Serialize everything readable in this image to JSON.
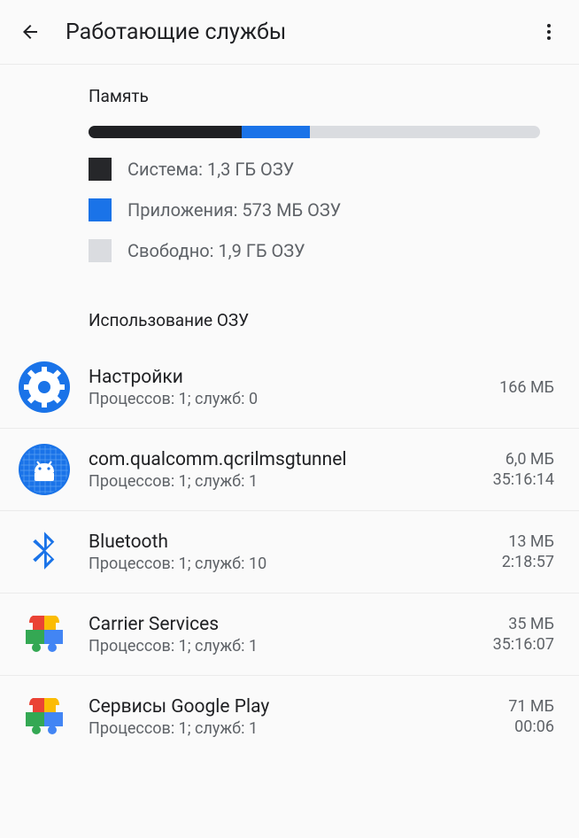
{
  "header": {
    "title": "Работающие службы"
  },
  "memory": {
    "label": "Память",
    "system": {
      "label": "Система: 1,3 ГБ ОЗУ",
      "fraction": 0.34
    },
    "apps": {
      "label": "Приложения: 573 МБ ОЗУ",
      "fraction": 0.15
    },
    "free": {
      "label": "Свободно: 1,9 ГБ ОЗУ",
      "fraction": 0.51
    }
  },
  "ram_usage": {
    "header": "Использование ОЗУ",
    "items": [
      {
        "icon": "settings-gear",
        "title": "Настройки",
        "sub": "Процессов: 1; служб: 0",
        "mem": "166 МБ",
        "time": ""
      },
      {
        "icon": "android-blue",
        "title": "com.qualcomm.qcrilmsgtunnel",
        "sub": "Процессов: 1; служб: 1",
        "mem": "6,0 МБ",
        "time": "35:16:14"
      },
      {
        "icon": "bluetooth",
        "title": "Bluetooth",
        "sub": "Процессов: 1; служб: 10",
        "mem": "13 МБ",
        "time": "2:18:57"
      },
      {
        "icon": "play-services",
        "title": "Carrier Services",
        "sub": "Процессов: 1; служб: 1",
        "mem": "35 МБ",
        "time": "35:16:07"
      },
      {
        "icon": "play-services",
        "title": "Сервисы Google Play",
        "sub": "Процессов: 1; служб: 1",
        "mem": "71 МБ",
        "time": "00:06"
      }
    ]
  }
}
